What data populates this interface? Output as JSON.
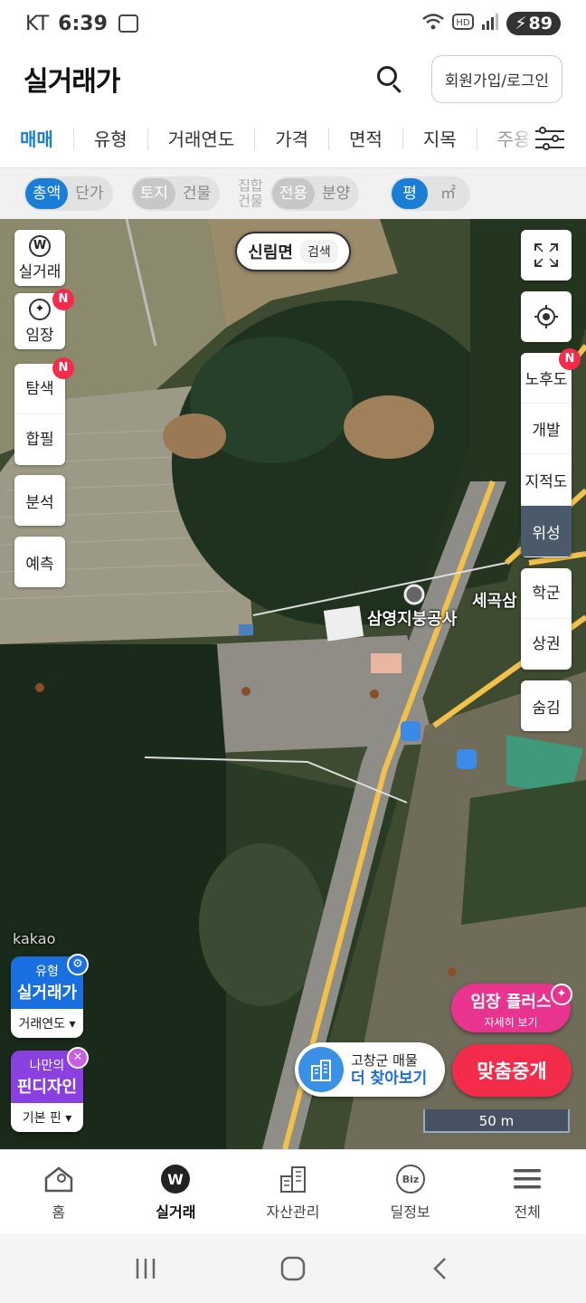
{
  "status": {
    "carrier": "KT",
    "time": "6:39",
    "battery": "89"
  },
  "header": {
    "title": "실거래가",
    "login_label": "회원가입/로그인"
  },
  "filters": {
    "tabs": [
      "매매",
      "유형",
      "거래연도",
      "가격",
      "면적",
      "지목",
      "주용"
    ]
  },
  "toggles": {
    "price": [
      "총액",
      "단가"
    ],
    "kind": [
      "토지",
      "건물"
    ],
    "group_label": [
      "집합",
      "건물"
    ],
    "area_type": [
      "전용",
      "분양"
    ],
    "unit": [
      "평",
      "㎡"
    ]
  },
  "map": {
    "place": "신림면",
    "place_search": "검색",
    "labels": {
      "business": "삼영지붕공사",
      "road": "세곡삼",
      "kakao": "kakao"
    },
    "scale": "50 m"
  },
  "left_buttons": {
    "realprice": "실거래",
    "forest": "임장",
    "explore": "탐색",
    "merge": "합필",
    "analysis": "분석",
    "forecast": "예측",
    "badge": "N"
  },
  "right_buttons": {
    "aging": "노후도",
    "develop": "개발",
    "cadastral": "지적도",
    "satellite": "위성",
    "school": "학군",
    "commerce": "상권",
    "hide": "숨김"
  },
  "cards": {
    "type_top": "유형",
    "type_main": "실거래가",
    "type_sub": "거래연도",
    "pin_top": "나만의",
    "pin_main": "핀디자인",
    "pin_sub": "기본 핀"
  },
  "cta": {
    "forest_title": "임장 플러스",
    "forest_sub": "자세히 보기",
    "more_top": "고창군 매물",
    "more_main": "더 찾아보기",
    "broker": "맞춤중개"
  },
  "bottom_nav": [
    "홈",
    "실거래",
    "자산관리",
    "딜정보",
    "전체"
  ],
  "colors": {
    "accent": "#1a7fd4",
    "red": "#f22c4a",
    "pink": "#e8338f"
  }
}
